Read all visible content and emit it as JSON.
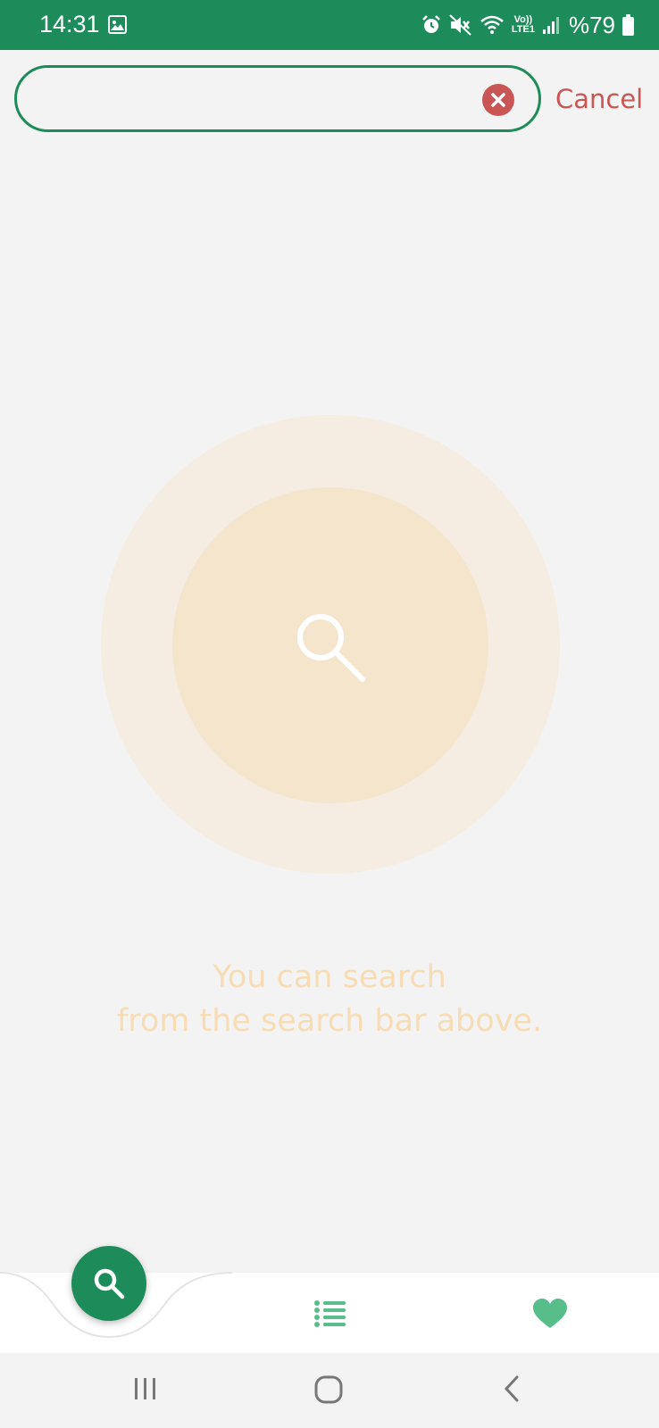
{
  "status_bar": {
    "time": "14:31",
    "network_label_top": "Vo))",
    "network_label_bottom": "LTE1",
    "battery": "%79",
    "icons": [
      "gallery-icon",
      "alarm-icon",
      "mute-icon",
      "wifi-icon",
      "signal-icon",
      "battery-icon"
    ]
  },
  "search": {
    "value": "",
    "placeholder": "",
    "cancel_label": "Cancel"
  },
  "empty_state": {
    "line1": "You can search",
    "line2": "from the search bar above."
  },
  "bottom_nav": {
    "items": [
      "search-icon",
      "list-icon",
      "heart-icon"
    ],
    "active": "search"
  },
  "colors": {
    "primary": "#1e8c5a",
    "danger": "#c95555",
    "hint_text": "#f7dcb4",
    "favorite": "#57be8a"
  }
}
